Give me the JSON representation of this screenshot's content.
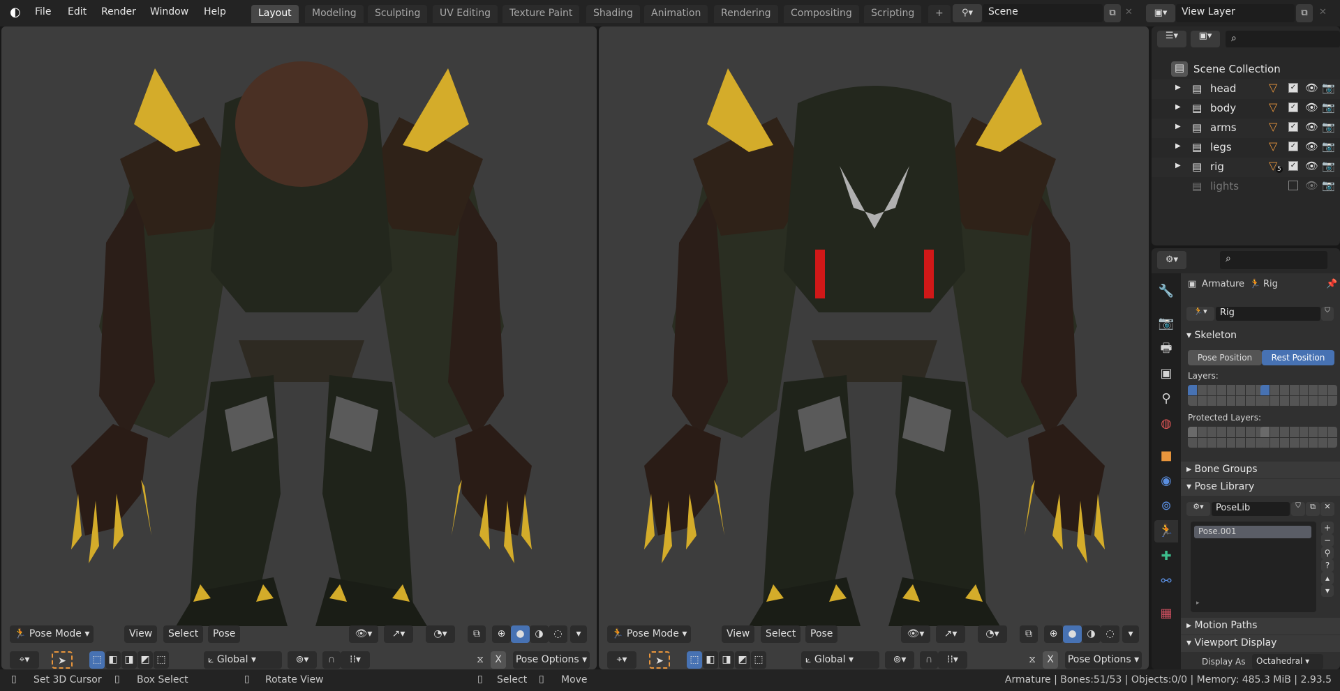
{
  "topbar": {
    "menus": [
      "File",
      "Edit",
      "Render",
      "Window",
      "Help"
    ],
    "workspaces": [
      "Layout",
      "Modeling",
      "Sculpting",
      "UV Editing",
      "Texture Paint",
      "Shading",
      "Animation",
      "Rendering",
      "Compositing",
      "Scripting"
    ],
    "active_workspace": "Layout",
    "add_tab": "+",
    "scene": "Scene",
    "view_layer": "View Layer"
  },
  "viewport_header": {
    "mode": "Pose Mode",
    "view": "View",
    "select": "Select",
    "pose": "Pose",
    "orientation": "Global",
    "x_mirror": "X",
    "pose_options": "Pose Options"
  },
  "outliner": {
    "root": "Scene Collection",
    "items": [
      {
        "name": "head",
        "enabled": true
      },
      {
        "name": "body",
        "enabled": true
      },
      {
        "name": "arms",
        "enabled": true
      },
      {
        "name": "legs",
        "enabled": true
      },
      {
        "name": "rig",
        "enabled": true,
        "badge": "5"
      },
      {
        "name": "lights",
        "enabled": false
      }
    ]
  },
  "properties": {
    "breadcrumb_object": "Armature",
    "breadcrumb_data": "Rig",
    "data_name": "Rig",
    "skeleton": "Skeleton",
    "pose_position": "Pose Position",
    "rest_position": "Rest Position",
    "active_position": "Rest Position",
    "layers_label": "Layers:",
    "protected_label": "Protected Layers:",
    "bone_groups": "Bone Groups",
    "pose_library": "Pose Library",
    "poselib": "PoseLib",
    "poses": [
      "Pose.001"
    ],
    "motion_paths": "Motion Paths",
    "viewport_display": "Viewport Display",
    "display_as_label": "Display As",
    "display_as": "Octahedral"
  },
  "statusbar": {
    "hints": [
      "Set 3D Cursor",
      "Box Select",
      "Rotate View",
      "Select",
      "Move"
    ],
    "info": "Armature | Bones:51/53 | Objects:0/0 | Memory: 485.3 MiB | 2.93.5"
  },
  "colors": {
    "accent": "#4772b3",
    "active_tab_green": "#3dbd8c",
    "yellow": "#d4ac2a",
    "orange": "#e8953c"
  }
}
